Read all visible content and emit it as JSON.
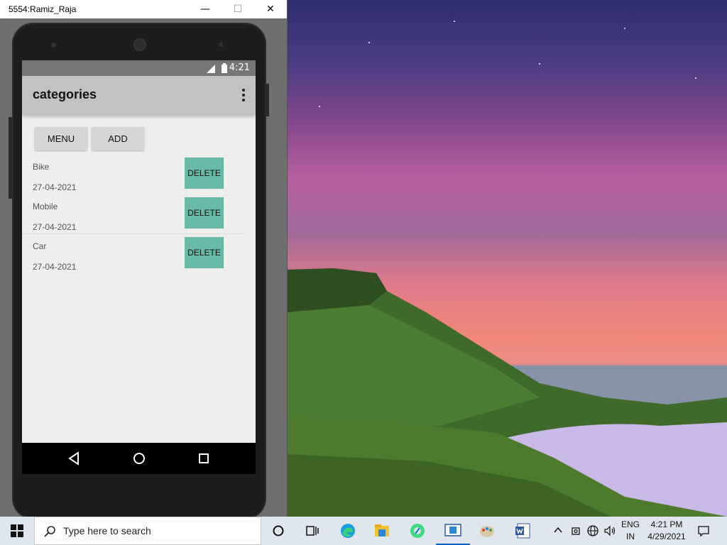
{
  "window": {
    "title": "5554:Ramiz_Raja",
    "minimize_glyph": "—",
    "maximize_glyph": "☐",
    "close_glyph": "✕"
  },
  "statusbar": {
    "time": "4:21"
  },
  "appbar": {
    "title": "categories",
    "overflow_icon": "more-vert-icon"
  },
  "buttons": {
    "menu": "MENU",
    "add": "ADD"
  },
  "categories": [
    {
      "name": "Bike",
      "date": "27-04-2021",
      "delete_label": "DELETE"
    },
    {
      "name": "Mobile",
      "date": "27-04-2021",
      "delete_label": "DELETE"
    },
    {
      "name": "Car",
      "date": "27-04-2021",
      "delete_label": "DELETE"
    }
  ],
  "navbar": {
    "back_icon": "back-triangle-icon",
    "home_icon": "home-circle-icon",
    "recents_icon": "recents-square-icon"
  },
  "taskbar": {
    "search_placeholder": "Type here to search",
    "language_line1": "ENG",
    "language_line2": "IN",
    "clock_time": "4:21 PM",
    "clock_date": "4/29/2021"
  },
  "colors": {
    "delete_button": "#67b8a6",
    "appbar": "#c2c2c2",
    "statusbar": "#777777"
  }
}
